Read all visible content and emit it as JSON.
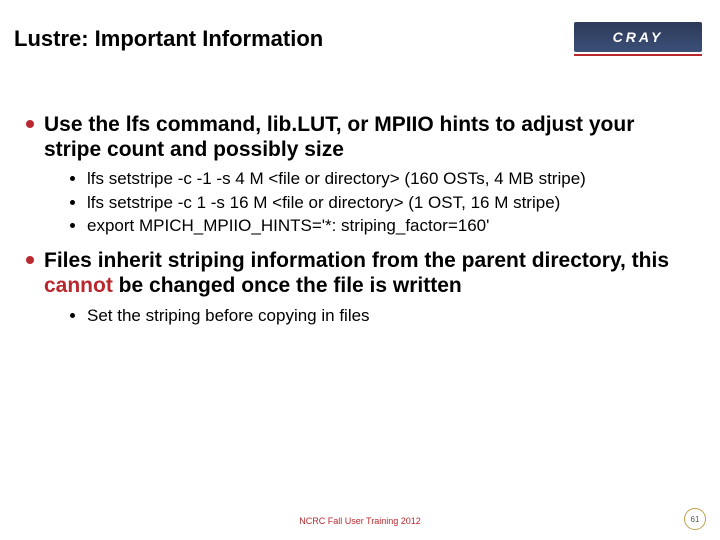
{
  "title": "Lustre: Important Information",
  "logo": {
    "text": "CRAY"
  },
  "bullets": [
    {
      "text": "Use the lfs command, lib.LUT, or MPIIO hints to adjust your stripe count and possibly size",
      "sub": [
        "lfs setstripe -c -1 -s 4 M <file or directory> (160 OSTs, 4 MB stripe)",
        "lfs setstripe -c 1 -s 16 M <file or directory> (1 OST, 16 M stripe)",
        "export MPICH_MPIIO_HINTS='*: striping_factor=160'"
      ]
    },
    {
      "text_pre": "Files inherit striping information from the parent directory, this ",
      "text_red": "cannot",
      "text_post": " be changed once the file is written",
      "sub": [
        "Set the striping before copying in files"
      ]
    }
  ],
  "footer": "NCRC Fall User Training 2012",
  "page_number": "61"
}
